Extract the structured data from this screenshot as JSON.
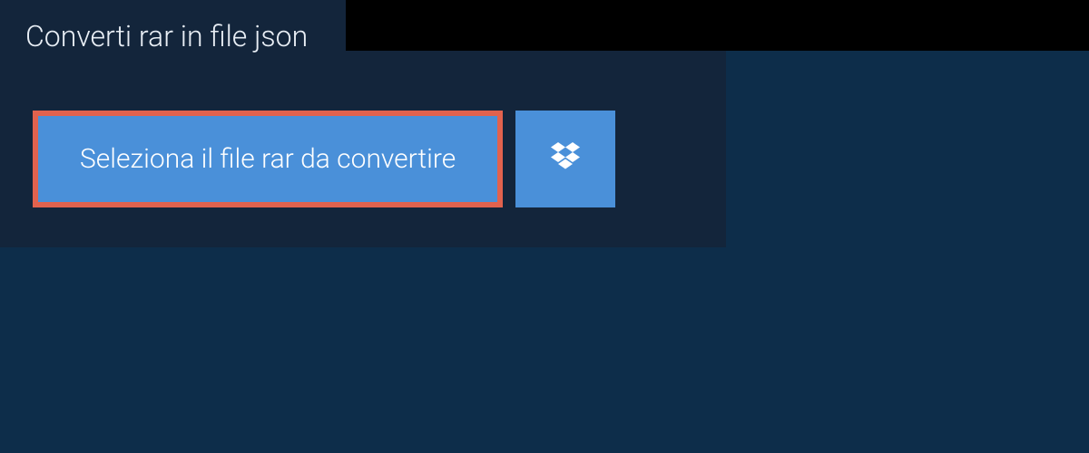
{
  "tab": {
    "title": "Converti rar in file json"
  },
  "actions": {
    "select_file_label": "Seleziona il file rar da convertire",
    "dropbox_icon": "dropbox"
  },
  "colors": {
    "page_bg": "#0d2d4a",
    "panel_bg": "#13253b",
    "tabbar_bg": "#000000",
    "button_bg": "#4a90d9",
    "highlight_border": "#e1624e"
  }
}
